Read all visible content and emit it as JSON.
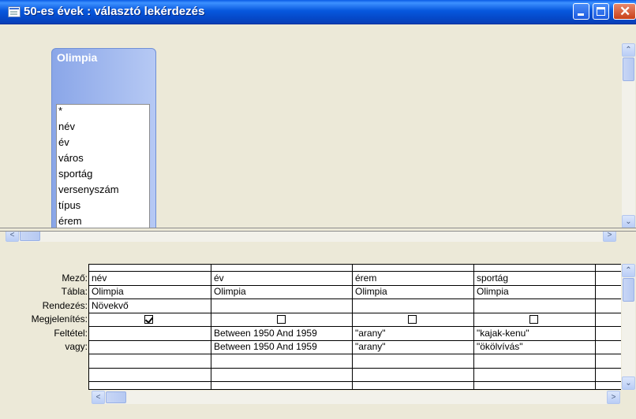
{
  "window": {
    "title": "50-es évek : választó lekérdezés"
  },
  "table": {
    "name": "Olimpia",
    "fields": [
      "*",
      "név",
      "év",
      "város",
      "sportág",
      "versenyszám",
      "típus",
      "érem"
    ]
  },
  "grid": {
    "row_labels": {
      "field": "Mező:",
      "table": "Tábla:",
      "sort": "Rendezés:",
      "show": "Megjelenítés:",
      "criteria": "Feltétel:",
      "or": "vagy:"
    },
    "columns": [
      {
        "field": "név",
        "table": "Olimpia",
        "sort": "Növekvő",
        "show": true,
        "criteria": "",
        "or": ""
      },
      {
        "field": "év",
        "table": "Olimpia",
        "sort": "",
        "show": false,
        "criteria": "Between 1950 And 1959",
        "or": "Between 1950 And 1959"
      },
      {
        "field": "érem",
        "table": "Olimpia",
        "sort": "",
        "show": false,
        "criteria": "\"arany\"",
        "or": "\"arany\""
      },
      {
        "field": "sportág",
        "table": "Olimpia",
        "sort": "",
        "show": false,
        "criteria": "\"kajak-kenu\"",
        "or": "\"ökölvívás\""
      }
    ]
  },
  "colors": {
    "titlebar": "#0758de",
    "table_header": "#8aa6e8",
    "pane_bg": "#ece9d8"
  },
  "icons": {
    "window": "query-window-icon",
    "minimize": "minimize-icon",
    "maximize": "maximize-icon",
    "close": "close-icon"
  }
}
